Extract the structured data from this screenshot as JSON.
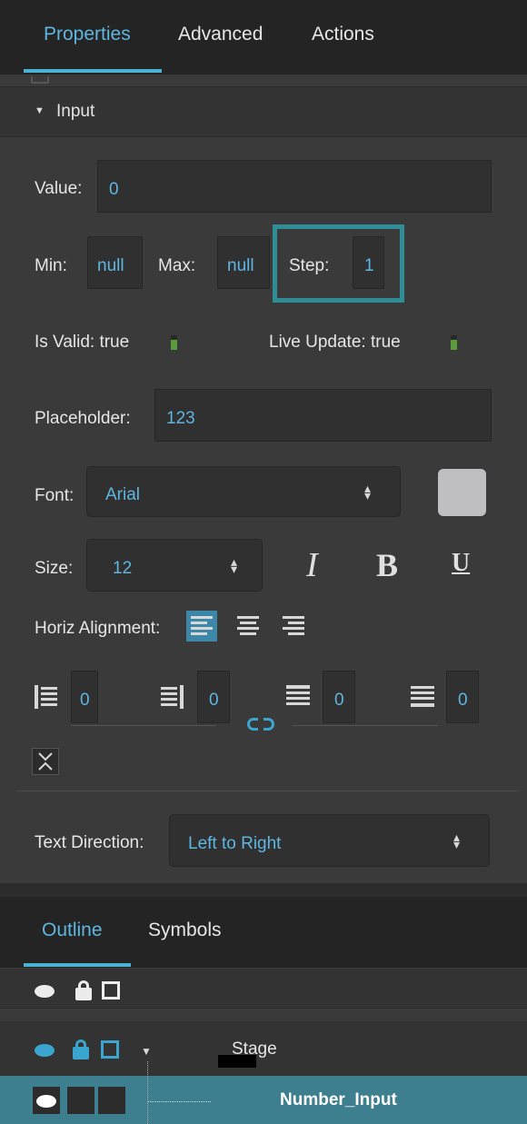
{
  "tabs": {
    "properties": "Properties",
    "advanced": "Advanced",
    "actions": "Actions"
  },
  "section": {
    "title": "Input",
    "arrow": "▼"
  },
  "fields": {
    "value_label": "Value:",
    "value": "0",
    "min_label": "Min:",
    "min": "null",
    "max_label": "Max:",
    "max": "null",
    "step_label": "Step:",
    "step": "1",
    "is_valid_label": "Is Valid: true",
    "live_update_label": "Live Update: true",
    "placeholder_label": "Placeholder:",
    "placeholder": "123",
    "font_label": "Font:",
    "font": "Arial",
    "size_label": "Size:",
    "size": "12",
    "horiz_alignment_label": "Horiz Alignment:",
    "padding_left": "0",
    "padding_right": "0",
    "padding_top": "0",
    "padding_bottom": "0",
    "text_direction_label": "Text Direction:",
    "text_direction": "Left to Right"
  },
  "format": {
    "italic": "I",
    "bold": "B",
    "underline": "U"
  },
  "outline": {
    "tab_outline": "Outline",
    "tab_symbols": "Symbols",
    "stage_label": "Stage",
    "selected_item": "Number_Input"
  },
  "colors": {
    "accent": "#5fb6e0",
    "highlight_border": "#2f8d98",
    "selected_row": "#3d7f8f",
    "toggle_on": "#5a9c3a"
  }
}
